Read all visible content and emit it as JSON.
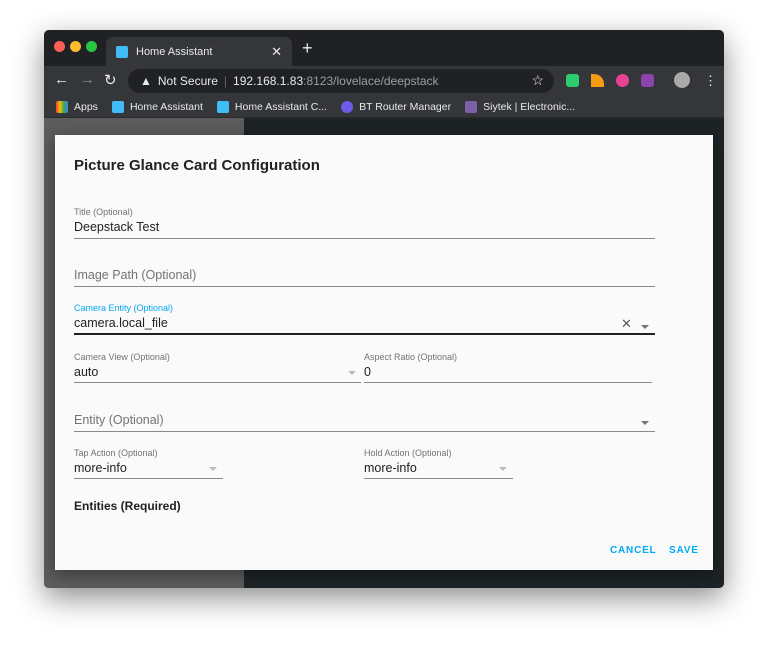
{
  "browser": {
    "tab_title": "Home Assistant",
    "security_label": "Not Secure",
    "url_host": "192.168.1.83",
    "url_rest": ":8123/lovelace/deepstack",
    "bookmarks": [
      "Apps",
      "Home Assistant",
      "Home Assistant C...",
      "BT Router Manager",
      "Siytek | Electronic..."
    ]
  },
  "dialog": {
    "title": "Picture Glance Card Configuration",
    "title_field": {
      "label": "Title (Optional)",
      "value": "Deepstack Test"
    },
    "image_path": {
      "placeholder": "Image Path (Optional)"
    },
    "camera_entity": {
      "label": "Camera Entity (Optional)",
      "value": "camera.local_file"
    },
    "camera_view": {
      "label": "Camera View (Optional)",
      "value": "auto"
    },
    "aspect_ratio": {
      "label": "Aspect Ratio (Optional)",
      "value": "0"
    },
    "entity": {
      "placeholder": "Entity (Optional)"
    },
    "tap_action": {
      "label": "Tap Action (Optional)",
      "value": "more-info"
    },
    "hold_action": {
      "label": "Hold Action (Optional)",
      "value": "more-info"
    },
    "entities_heading": "Entities (Required)",
    "cancel_label": "CANCEL",
    "save_label": "SAVE",
    "accent_color": "#03a9f4"
  }
}
